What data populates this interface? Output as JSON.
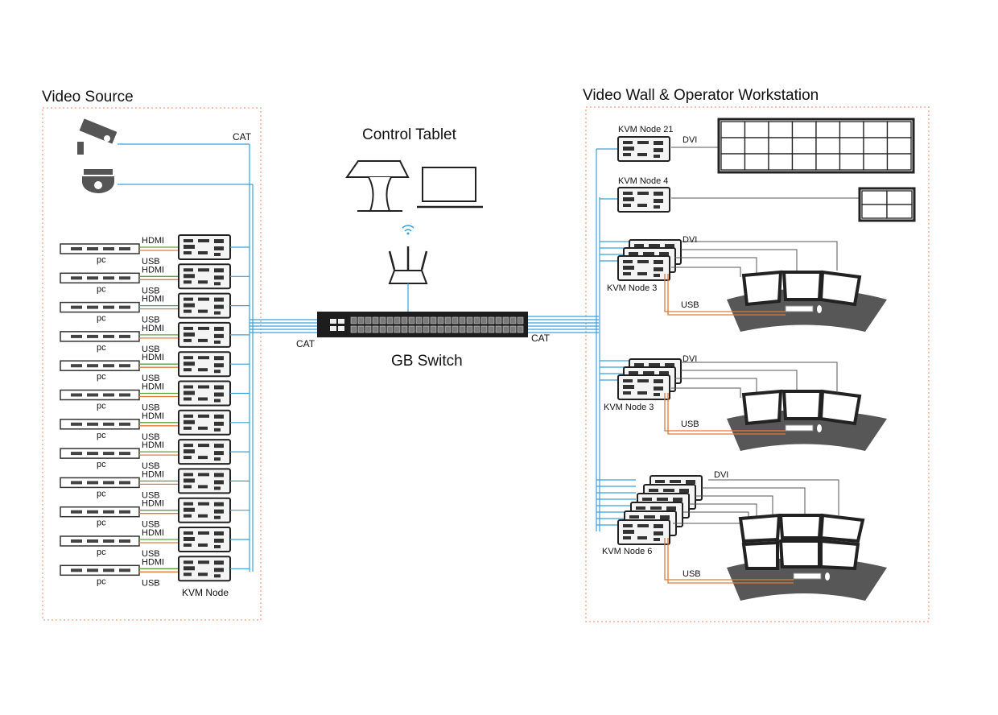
{
  "sections": {
    "video_source": "Video Source",
    "video_wall": "Video Wall & Operator Workstation"
  },
  "center": {
    "control_tablet": "Control Tablet",
    "switch": "GB Switch",
    "cat_left": "CAT",
    "cat_right": "CAT"
  },
  "cameras": {
    "cat": "CAT"
  },
  "pc_rows": {
    "count": 12,
    "pc": "pc",
    "hdmi": "HDMI",
    "usb": "USB"
  },
  "kvm_node": "KVM Node",
  "right": {
    "node21": "KVM Node 21",
    "node4": "KVM Node 4",
    "node3a": "KVM Node 3",
    "node3b": "KVM Node 3",
    "node6": "KVM Node 6",
    "dvi": "DVI",
    "usb": "USB"
  },
  "colors": {
    "cat": "#3aa0d8",
    "hdmi": "#5aa03a",
    "usb": "#e07a3a",
    "dvi": "#555555",
    "frame": "#f0a080"
  }
}
